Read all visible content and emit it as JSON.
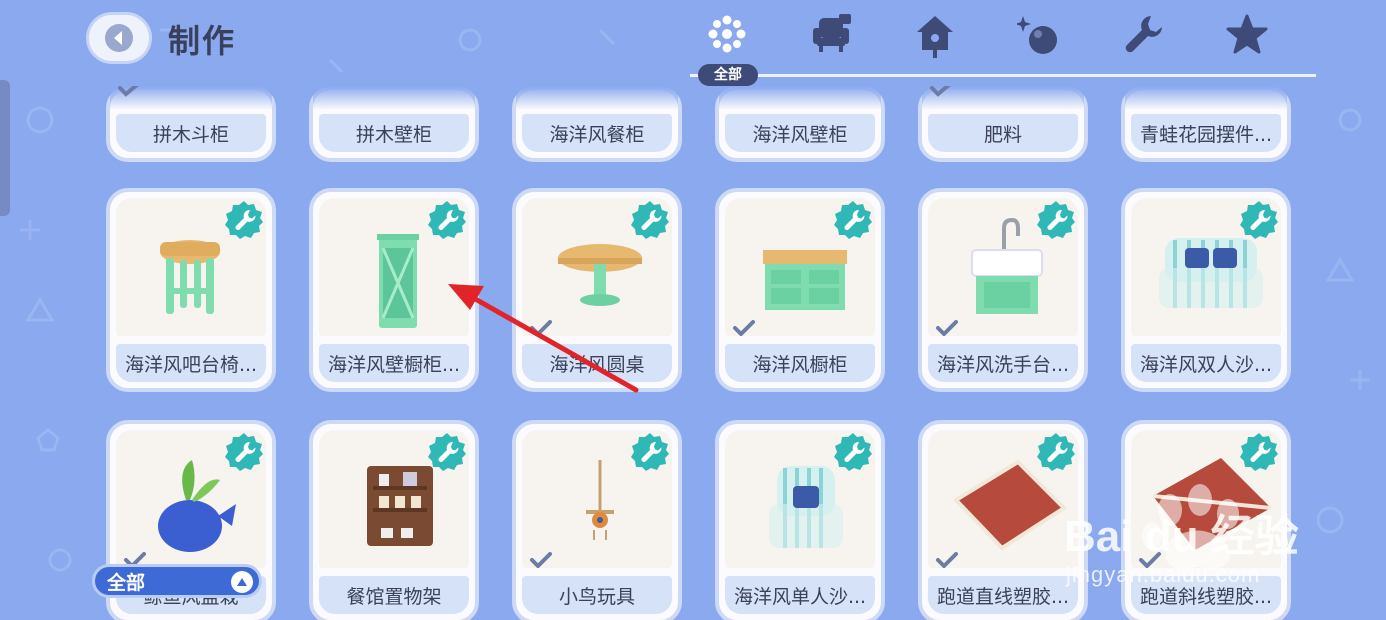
{
  "header": {
    "title": "制作",
    "tabs": [
      {
        "icon": "dots-grid-icon",
        "label": "全部",
        "active": true
      },
      {
        "icon": "armchair-icon"
      },
      {
        "icon": "birdhouse-icon"
      },
      {
        "icon": "sparkle-ball-icon"
      },
      {
        "icon": "wrench-icon"
      },
      {
        "icon": "star-icon"
      }
    ]
  },
  "items_row1": [
    {
      "name": "拼木斗柜",
      "checked": true
    },
    {
      "name": "拼木壁柜"
    },
    {
      "name": "海洋风餐柜"
    },
    {
      "name": "海洋风壁柜"
    },
    {
      "name": "肥料",
      "checked": true
    },
    {
      "name": "青蛙花园摆件..."
    }
  ],
  "items_row2": [
    {
      "name": "海洋风吧台椅...",
      "icon": "bar-stool-icon"
    },
    {
      "name": "海洋风壁橱柜...",
      "icon": "wall-cabinet-icon"
    },
    {
      "name": "海洋风圆桌",
      "icon": "round-table-icon",
      "checked": true
    },
    {
      "name": "海洋风橱柜",
      "icon": "cupboard-icon",
      "checked": true
    },
    {
      "name": "海洋风洗手台...",
      "icon": "sink-icon",
      "checked": true
    },
    {
      "name": "海洋风双人沙...",
      "icon": "loveseat-icon"
    }
  ],
  "items_row3": [
    {
      "name": "鲸鱼风盆栽",
      "icon": "whale-planter-icon",
      "checked": true
    },
    {
      "name": "餐馆置物架",
      "icon": "restaurant-shelf-icon"
    },
    {
      "name": "小鸟玩具",
      "icon": "bird-toy-icon",
      "checked": true
    },
    {
      "name": "海洋风单人沙...",
      "icon": "armchair-icon"
    },
    {
      "name": "跑道直线塑胶...",
      "icon": "track-straight-icon",
      "checked": true
    },
    {
      "name": "跑道斜线塑胶...",
      "icon": "track-diagonal-icon",
      "checked": true
    }
  ],
  "filter": {
    "label": "全部"
  },
  "watermark": {
    "brand": "Bai du 经验",
    "url": "jingyan.baidu.com"
  },
  "colors": {
    "background": "#8aa9ef",
    "accent": "#2fb8b6",
    "pill": "#3e6ad6",
    "annotation_arrow": "#e0242a"
  }
}
